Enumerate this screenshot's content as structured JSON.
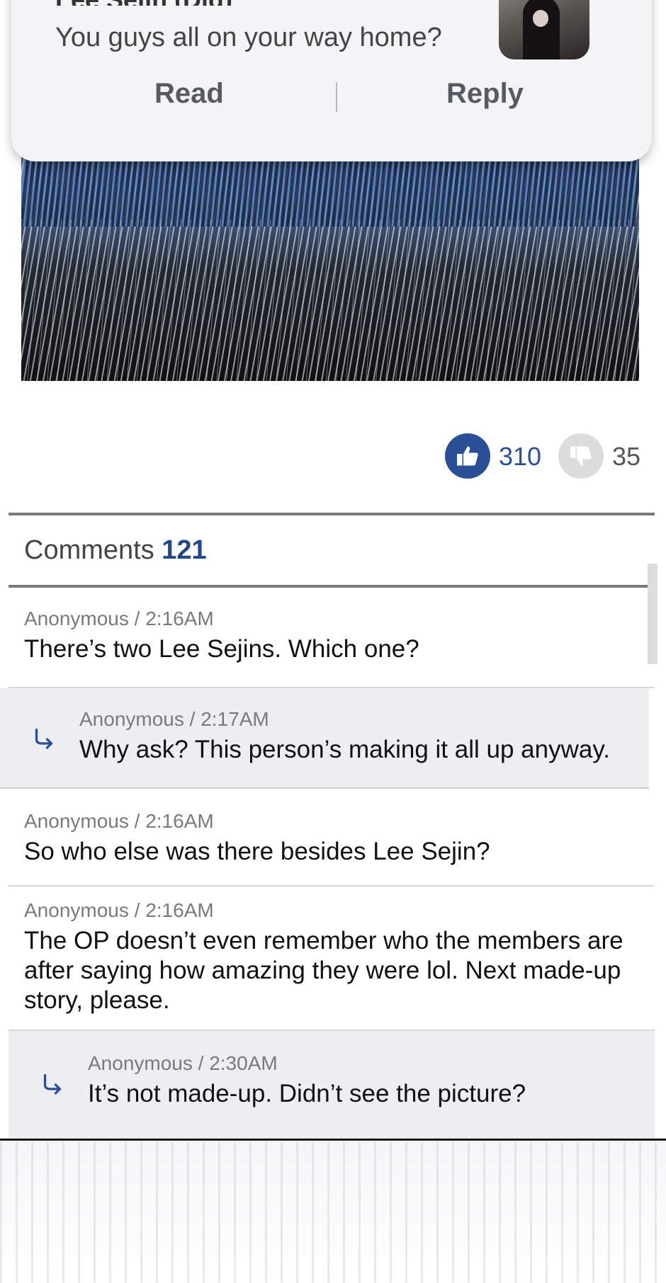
{
  "notification": {
    "sender": "Lee Sejin (Dig)",
    "message": "You guys all on your way home?",
    "read_label": "Read",
    "reply_label": "Reply"
  },
  "votes": {
    "likes": "310",
    "dislikes": "35",
    "like_icon": "thumbs-up-icon",
    "dislike_icon": "thumbs-down-icon"
  },
  "comments": {
    "label": "Comments",
    "count": "121",
    "items": [
      {
        "meta": "Anonymous / 2:16AM",
        "text": "There’s two Lee Sejins. Which one?",
        "is_reply": false
      },
      {
        "meta": "Anonymous / 2:17AM",
        "text": "Why ask? This person’s making it all up anyway.",
        "is_reply": true
      },
      {
        "meta": "Anonymous / 2:16AM",
        "text": "So who else was there besides Lee Sejin?",
        "is_reply": false
      },
      {
        "meta": "Anonymous / 2:16AM",
        "text": "The OP doesn’t even remember who the members are after saying how amazing they were lol. Next made-up story, please.",
        "is_reply": false
      },
      {
        "meta": "Anonymous / 2:30AM",
        "text": "It’s not made-up. Didn’t see the picture?",
        "is_reply": true
      }
    ]
  },
  "colors": {
    "accent": "#2b4f96",
    "reply_bg": "#eceef2",
    "dislike_bg": "#dcdcdc"
  }
}
